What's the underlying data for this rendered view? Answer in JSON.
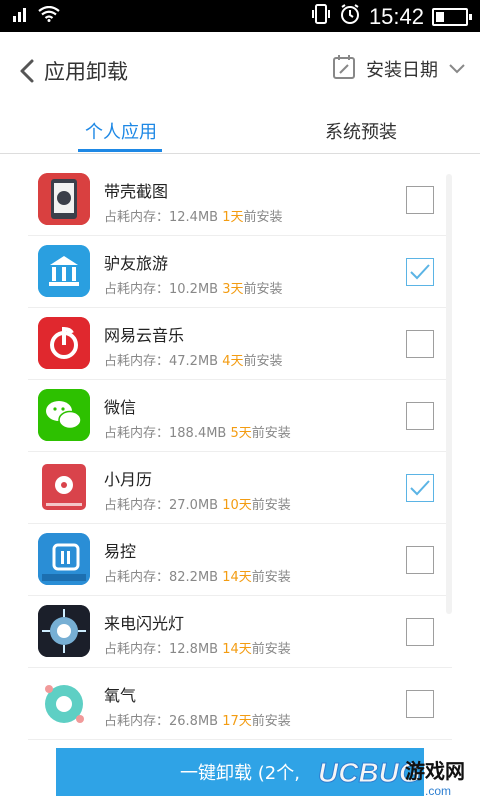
{
  "status_bar": {
    "time": "15:42"
  },
  "header": {
    "title": "应用卸载",
    "sort_label": "安装日期"
  },
  "tabs": [
    {
      "label": "个人应用"
    },
    {
      "label": "系统预装"
    }
  ],
  "apps": [
    {
      "name": "带壳截图",
      "size": "占耗内存：12.4MB",
      "days": "1天",
      "suffix": "前安装",
      "checked": false
    },
    {
      "name": "驴友旅游",
      "size": "占耗内存：10.2MB",
      "days": "3天",
      "suffix": "前安装",
      "checked": true
    },
    {
      "name": "网易云音乐",
      "size": "占耗内存：47.2MB",
      "days": "4天",
      "suffix": "前安装",
      "checked": false
    },
    {
      "name": "微信",
      "size": "占耗内存：188.4MB",
      "days": "5天",
      "suffix": "前安装",
      "checked": false
    },
    {
      "name": "小月历",
      "size": "占耗内存：27.0MB",
      "days": "10天",
      "suffix": "前安装",
      "checked": true
    },
    {
      "name": "易控",
      "size": "占耗内存：82.2MB",
      "days": "14天",
      "suffix": "前安装",
      "checked": false
    },
    {
      "name": "来电闪光灯",
      "size": "占耗内存：12.8MB",
      "days": "14天",
      "suffix": "前安装",
      "checked": false
    },
    {
      "name": "氧气",
      "size": "占耗内存：26.8MB",
      "days": "17天",
      "suffix": "前安装",
      "checked": false
    }
  ],
  "bottom_button": {
    "label": "一键卸载 (2个,"
  },
  "watermark": {
    "brand": "UCBUG",
    "suffix": "游戏网",
    "domain": ".com"
  },
  "colors": {
    "accent": "#1e88e5",
    "button": "#2fa3e6",
    "days": "#f39c12"
  }
}
